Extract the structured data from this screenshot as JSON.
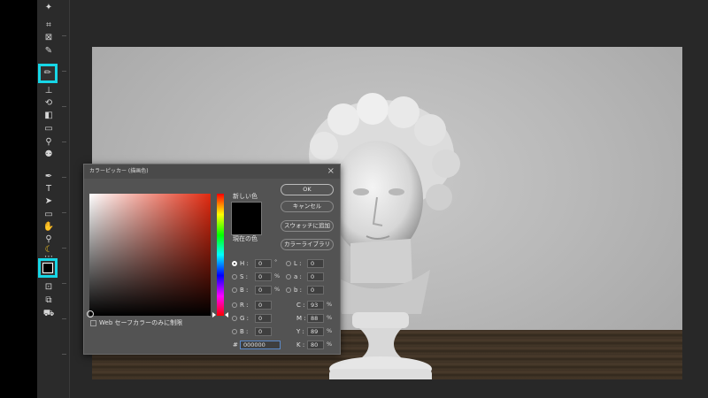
{
  "toolbar": {
    "tools": [
      {
        "name": "quick-select-icon",
        "glyph": "✦"
      },
      {
        "name": "crop-icon",
        "glyph": "⌗"
      },
      {
        "name": "frame-icon",
        "glyph": "⊠"
      },
      {
        "name": "eyedropper-icon",
        "glyph": "✎"
      },
      {
        "name": "brush-icon",
        "glyph": "✏"
      },
      {
        "name": "stamp-icon",
        "glyph": "⊥"
      },
      {
        "name": "history-brush-icon",
        "glyph": "⟲"
      },
      {
        "name": "eraser-icon",
        "glyph": "◧"
      },
      {
        "name": "gradient-icon",
        "glyph": "▭"
      },
      {
        "name": "blur-icon",
        "glyph": "⚲"
      },
      {
        "name": "dodge-icon",
        "glyph": "⚉"
      },
      {
        "name": "pen-icon",
        "glyph": "✒"
      },
      {
        "name": "type-icon",
        "glyph": "T"
      },
      {
        "name": "path-select-icon",
        "glyph": "➤"
      },
      {
        "name": "rectangle-icon",
        "glyph": "▭"
      },
      {
        "name": "hand-icon",
        "glyph": "✋"
      },
      {
        "name": "zoom-icon",
        "glyph": "⚲"
      },
      {
        "name": "banana-icon",
        "glyph": "☾"
      },
      {
        "name": "edit-toolbar-icon",
        "glyph": "⋯"
      },
      {
        "name": "color-swatches-icon",
        "glyph": ""
      },
      {
        "name": "quick-mask-icon",
        "glyph": "⊡"
      },
      {
        "name": "screen-mode-icon",
        "glyph": "⧉"
      },
      {
        "name": "extras-icon",
        "glyph": "⛟"
      }
    ]
  },
  "color_picker": {
    "title": "カラーピッカー (描画色)",
    "new_label": "新しい色",
    "current_label": "現在の色",
    "buttons": {
      "ok": "OK",
      "cancel": "キャンセル",
      "add_swatch": "スウォッチに追加",
      "color_libraries": "カラーライブラリ"
    },
    "web_safe_label": "Web セーフカラーのみに制限",
    "fields": {
      "H": {
        "label": "H :",
        "value": "0",
        "unit": "°"
      },
      "S": {
        "label": "S :",
        "value": "0",
        "unit": "%"
      },
      "B": {
        "label": "B :",
        "value": "0",
        "unit": "%"
      },
      "R": {
        "label": "R :",
        "value": "0"
      },
      "G": {
        "label": "G :",
        "value": "0"
      },
      "Bl": {
        "label": "B :",
        "value": "0"
      },
      "L": {
        "label": "L :",
        "value": "0"
      },
      "a": {
        "label": "a :",
        "value": "0"
      },
      "b": {
        "label": "b :",
        "value": "0"
      },
      "C": {
        "label": "C :",
        "value": "93",
        "unit": "%"
      },
      "M": {
        "label": "M :",
        "value": "88",
        "unit": "%"
      },
      "Y": {
        "label": "Y :",
        "value": "89",
        "unit": "%"
      },
      "K": {
        "label": "K :",
        "value": "80",
        "unit": "%"
      }
    },
    "hex_label": "#",
    "hex_value": "000000",
    "new_color": "#000000",
    "hue_color": "#e12a10"
  },
  "colors": {
    "highlight": "#17d6e6"
  }
}
